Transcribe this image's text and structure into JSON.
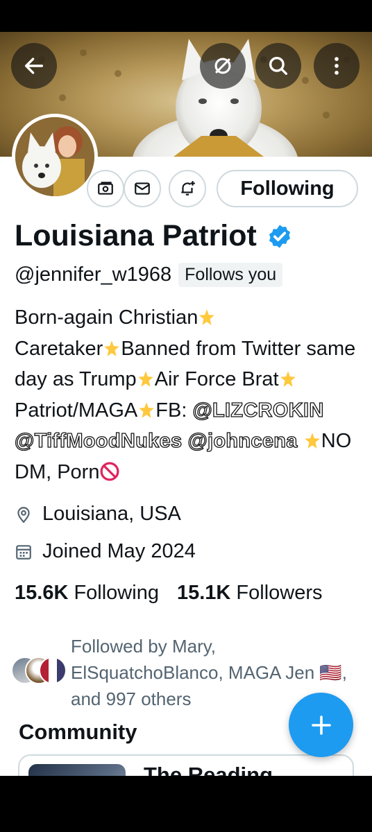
{
  "header": {
    "icons": [
      "back-arrow-icon",
      "mute-off-icon",
      "search-icon",
      "more-vertical-icon"
    ]
  },
  "profile": {
    "display_name": "Louisiana Patriot",
    "handle": "@jennifer_w1968",
    "follows_you_label": "Follows you",
    "verified": true,
    "following_button_label": "Following",
    "action_icons": [
      "money-icon",
      "message-icon",
      "bell-plus-icon"
    ],
    "bio": {
      "parts": [
        "Born-again Christian",
        "Caretaker",
        "Banned from Twitter same day as Trump",
        "Air Force Brat",
        "Patriot/MAGA",
        "FB: ",
        "@LIZCROKIN",
        "@TiffMoodNukes",
        "@johncena",
        "NO DM, Porn"
      ]
    },
    "location": "Louisiana, USA",
    "joined": "Joined May 2024",
    "following_count": "15.6K",
    "following_label": "Following",
    "followers_count": "15.1K",
    "followers_label": "Followers",
    "followed_by": "Followed by Mary, ElSquatchoBlanco, MAGA Jen 🇺🇸, and 997 others"
  },
  "community": {
    "heading": "Community",
    "card_title": "The Reading"
  },
  "fab": {
    "icon": "plus-icon"
  },
  "colors": {
    "accent": "#1d9bf0",
    "text": "#0f1419",
    "muted": "#536471",
    "border": "#cfd9de"
  }
}
